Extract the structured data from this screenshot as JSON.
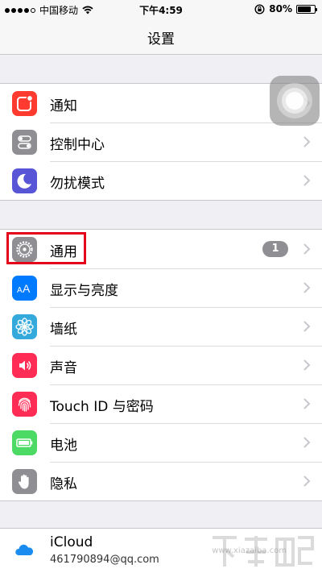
{
  "status_bar": {
    "carrier": "中国移动",
    "time": "下午4:59",
    "battery": "80%",
    "battery_level": 0.8,
    "icons": [
      "signal-dots-icon",
      "wifi-icon",
      "rotation-lock-icon",
      "battery-icon"
    ]
  },
  "nav": {
    "title": "设置"
  },
  "group1": {
    "items": [
      {
        "label": "通知",
        "icon": "notifications-icon",
        "color": "#ff3b30"
      },
      {
        "label": "控制中心",
        "icon": "control-center-icon",
        "color": "#8e8e93"
      },
      {
        "label": "勿扰模式",
        "icon": "moon-icon",
        "color": "#5856d6"
      }
    ]
  },
  "group2": {
    "items": [
      {
        "label": "通用",
        "icon": "gear-icon",
        "color": "#8e8e93",
        "badge": "1"
      },
      {
        "label": "显示与亮度",
        "icon": "display-brightness-icon",
        "color": "#007aff"
      },
      {
        "label": "墙纸",
        "icon": "wallpaper-flower-icon",
        "color": "#34aadc"
      },
      {
        "label": "声音",
        "icon": "speaker-icon",
        "color": "#ff2d55"
      },
      {
        "label": "Touch ID 与密码",
        "icon": "fingerprint-icon",
        "color": "#ff2d55"
      },
      {
        "label": "电池",
        "icon": "battery-icon",
        "color": "#4cd964"
      },
      {
        "label": "隐私",
        "icon": "hand-icon",
        "color": "#8e8e93"
      }
    ]
  },
  "group3": {
    "items": [
      {
        "label": "iCloud",
        "sublabel": "461790894@qq.com",
        "icon": "icloud-icon",
        "color": "#1a8cf0"
      }
    ]
  },
  "watermark": {
    "url": "www.xiazaiba.com"
  },
  "highlight_color": "#e3001b"
}
